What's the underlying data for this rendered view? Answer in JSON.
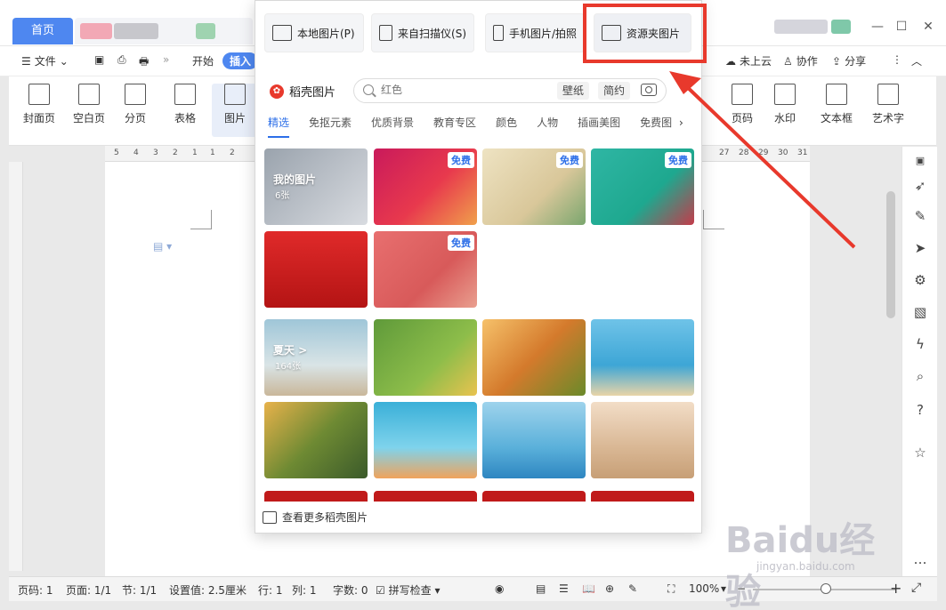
{
  "title_bar": {
    "home_tab": "首页"
  },
  "toolbar": {
    "file_menu": "文件",
    "start_tab": "开始",
    "insert_tab": "插入",
    "cloud": "未上云",
    "collab": "协作",
    "share": "分享"
  },
  "ribbon": {
    "items": [
      {
        "label": "封面页"
      },
      {
        "label": "空白页"
      },
      {
        "label": "分页"
      },
      {
        "label": "表格"
      },
      {
        "label": "图片"
      },
      {
        "label": "页码"
      },
      {
        "label": "水印"
      },
      {
        "label": "文本框"
      },
      {
        "label": "艺术字"
      }
    ]
  },
  "ruler_numbers": [
    "5",
    "4",
    "3",
    "2",
    "1",
    "1",
    "2",
    "27",
    "28",
    "29",
    "30",
    "31"
  ],
  "popup": {
    "sources": [
      {
        "label": "本地图片(P)"
      },
      {
        "label": "来自扫描仪(S)"
      },
      {
        "label": "手机图片/拍照"
      },
      {
        "label": "资源夹图片"
      }
    ],
    "brand": "稻壳图片",
    "search": {
      "placeholder": "红色",
      "tag1": "壁纸",
      "tag2": "简约"
    },
    "categories": [
      "精选",
      "免抠元素",
      "优质背景",
      "教育专区",
      "颜色",
      "人物",
      "插画美图",
      "免费图"
    ],
    "badge": "免费",
    "my_images": {
      "title": "我的图片",
      "count": "6张"
    },
    "summer": {
      "title": "夏天 >",
      "count": "164张"
    },
    "more_link": "查看更多稻壳图片"
  },
  "statusbar": {
    "page_num": "页码: 1",
    "pages": "页面: 1/1",
    "section": "节: 1/1",
    "setting": "设置值: 2.5厘米",
    "row": "行: 1",
    "col": "列: 1",
    "words": "字数: 0",
    "spell": "拼写检查",
    "zoom": "100%"
  },
  "watermark": {
    "main": "Baidu经验",
    "sub": "jingyan.baidu.com"
  },
  "colors": {
    "accent": "#4e87f0",
    "highlight": "#e8392c",
    "brand_red": "#e8392c"
  }
}
